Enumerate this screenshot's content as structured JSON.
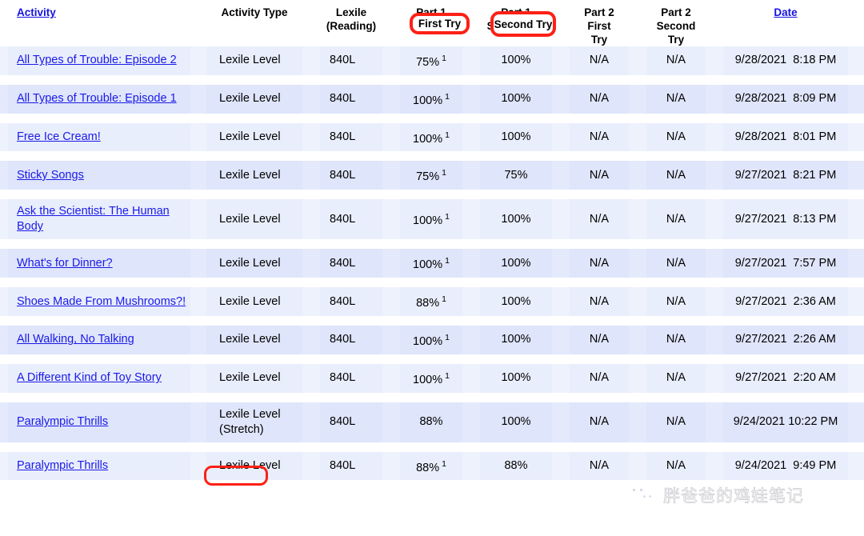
{
  "table": {
    "columns": [
      {
        "key": "activity",
        "label": "Activity",
        "is_link": true,
        "lines": [
          "Activity"
        ]
      },
      {
        "key": "activity_type",
        "label": "Activity Type",
        "is_link": false,
        "lines": [
          "Activity Type"
        ]
      },
      {
        "key": "lexile",
        "label": "Lexile (Reading)",
        "is_link": false,
        "lines": [
          "Lexile",
          "(Reading)"
        ]
      },
      {
        "key": "p1_first",
        "label": "Part 1 First Try",
        "is_link": false,
        "lines": [
          "Part 1",
          "First Try"
        ]
      },
      {
        "key": "p1_second",
        "label": "Part 1 Second Try",
        "is_link": false,
        "lines": [
          "Part 1",
          "Second Try"
        ]
      },
      {
        "key": "p2_first",
        "label": "Part 2 First Try",
        "is_link": false,
        "lines": [
          "Part 2",
          "First",
          "Try"
        ]
      },
      {
        "key": "p2_second",
        "label": "Part 2 Second Try",
        "is_link": false,
        "lines": [
          "Part 2",
          "Second",
          "Try"
        ]
      },
      {
        "key": "date",
        "label": "Date",
        "is_link": true,
        "lines": [
          "Date"
        ]
      }
    ],
    "headers": {
      "activity": "Activity",
      "activity_type": "Activity Type",
      "lexile_l1": "Lexile",
      "lexile_l2": "(Reading)",
      "p1_l1": "Part 1",
      "p1_first_try": "First Try",
      "p1b_l1": "Part 1",
      "p1_second_try": "Second Try",
      "p2_l1": "Part 2",
      "p2_l2": "First",
      "p2_l3": "Try",
      "p2b_l1": "Part 2",
      "p2b_l2": "Second",
      "p2b_l3": "Try",
      "date": "Date"
    },
    "rows": [
      {
        "activity": "All Types of Trouble: Episode 2",
        "activity_type": "Lexile Level",
        "activity_type_note": "",
        "lexile": "840L",
        "p1_first": "75%",
        "p1_first_sup": "1",
        "p1_second": "100%",
        "p2_first": "N/A",
        "p2_second": "N/A",
        "date": "9/28/2021  8:18 PM"
      },
      {
        "activity": "All Types of Trouble: Episode 1",
        "activity_type": "Lexile Level",
        "activity_type_note": "",
        "lexile": "840L",
        "p1_first": "100%",
        "p1_first_sup": "1",
        "p1_second": "100%",
        "p2_first": "N/A",
        "p2_second": "N/A",
        "date": "9/28/2021  8:09 PM"
      },
      {
        "activity": "Free Ice Cream!",
        "activity_type": "Lexile Level",
        "activity_type_note": "",
        "lexile": "840L",
        "p1_first": "100%",
        "p1_first_sup": "1",
        "p1_second": "100%",
        "p2_first": "N/A",
        "p2_second": "N/A",
        "date": "9/28/2021  8:01 PM"
      },
      {
        "activity": "Sticky Songs",
        "activity_type": "Lexile Level",
        "activity_type_note": "",
        "lexile": "840L",
        "p1_first": "75%",
        "p1_first_sup": "1",
        "p1_second": "75%",
        "p2_first": "N/A",
        "p2_second": "N/A",
        "date": "9/27/2021  8:21 PM"
      },
      {
        "activity": "Ask the Scientist: The Human Body",
        "activity_type": "Lexile Level",
        "activity_type_note": "",
        "lexile": "840L",
        "p1_first": "100%",
        "p1_first_sup": "1",
        "p1_second": "100%",
        "p2_first": "N/A",
        "p2_second": "N/A",
        "date": "9/27/2021  8:13 PM"
      },
      {
        "activity": "What's for Dinner?",
        "activity_type": "Lexile Level",
        "activity_type_note": "",
        "lexile": "840L",
        "p1_first": "100%",
        "p1_first_sup": "1",
        "p1_second": "100%",
        "p2_first": "N/A",
        "p2_second": "N/A",
        "date": "9/27/2021  7:57 PM"
      },
      {
        "activity": "Shoes Made From Mushrooms?!",
        "activity_type": "Lexile Level",
        "activity_type_note": "",
        "lexile": "840L",
        "p1_first": "88%",
        "p1_first_sup": "1",
        "p1_second": "100%",
        "p2_first": "N/A",
        "p2_second": "N/A",
        "date": "9/27/2021  2:36 AM"
      },
      {
        "activity": "All Walking, No Talking",
        "activity_type": "Lexile Level",
        "activity_type_note": "",
        "lexile": "840L",
        "p1_first": "100%",
        "p1_first_sup": "1",
        "p1_second": "100%",
        "p2_first": "N/A",
        "p2_second": "N/A",
        "date": "9/27/2021  2:26 AM"
      },
      {
        "activity": "A Different Kind of Toy Story",
        "activity_type": "Lexile Level",
        "activity_type_note": "",
        "lexile": "840L",
        "p1_first": "100%",
        "p1_first_sup": "1",
        "p1_second": "100%",
        "p2_first": "N/A",
        "p2_second": "N/A",
        "date": "9/27/2021  2:20 AM"
      },
      {
        "activity": "Paralympic Thrills",
        "activity_type": "Lexile Level",
        "activity_type_note": "(Stretch)",
        "lexile": "840L",
        "p1_first": "88%",
        "p1_first_sup": "",
        "p1_second": "100%",
        "p2_first": "N/A",
        "p2_second": "N/A",
        "date": "9/24/2021 10:22 PM"
      },
      {
        "activity": "Paralympic Thrills",
        "activity_type": "Lexile Level",
        "activity_type_note": "",
        "lexile": "840L",
        "p1_first": "88%",
        "p1_first_sup": "1",
        "p1_second": "88%",
        "p2_first": "N/A",
        "p2_second": "N/A",
        "date": "9/24/2021  9:49 PM"
      }
    ]
  },
  "annotations": {
    "color": "#fd2015",
    "first_try": "First Try",
    "second_try": "Second Try",
    "stretch": "(Stretch)"
  },
  "watermark": {
    "text": "胖爸爸的鸡娃笔记",
    "icon": "wechat-icon"
  },
  "colors": {
    "link": "#1a1ae8",
    "row_odd": "#e9eefc",
    "row_even": "#dfe5fa",
    "annotation_red": "#fd2015",
    "background": "#ffffff"
  }
}
